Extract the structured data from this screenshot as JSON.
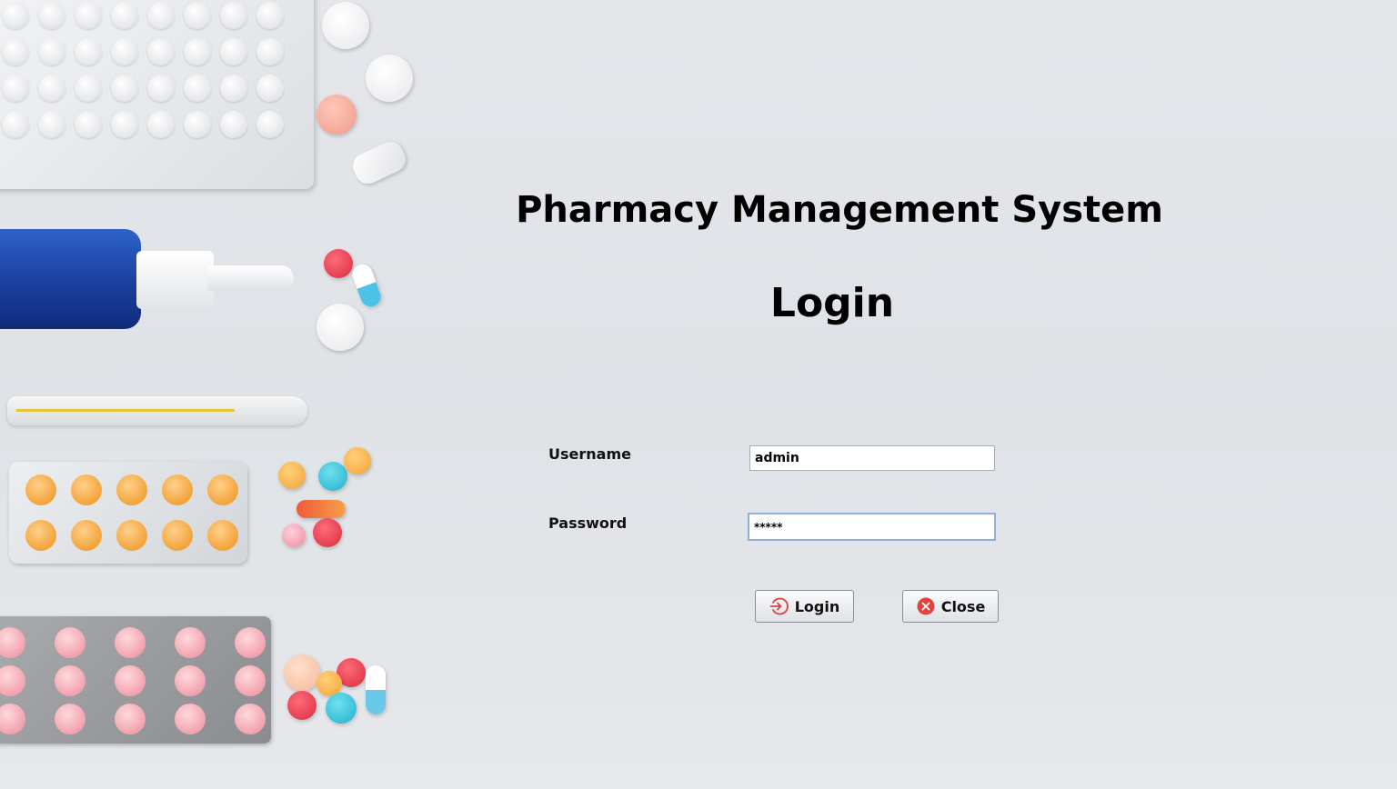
{
  "app": {
    "title": "Pharmacy Management System",
    "heading": "Login"
  },
  "form": {
    "username_label": "Username",
    "username_value": "admin",
    "password_label": "Password",
    "password_value": "*****"
  },
  "buttons": {
    "login_label": "Login",
    "close_label": "Close"
  },
  "icons": {
    "login": "login-arrow-icon",
    "close": "close-circle-icon"
  },
  "colors": {
    "background": "#e2e5e9",
    "focus_border": "#8fb0d8",
    "login_icon": "#d9423a",
    "close_icon": "#e0443c"
  }
}
